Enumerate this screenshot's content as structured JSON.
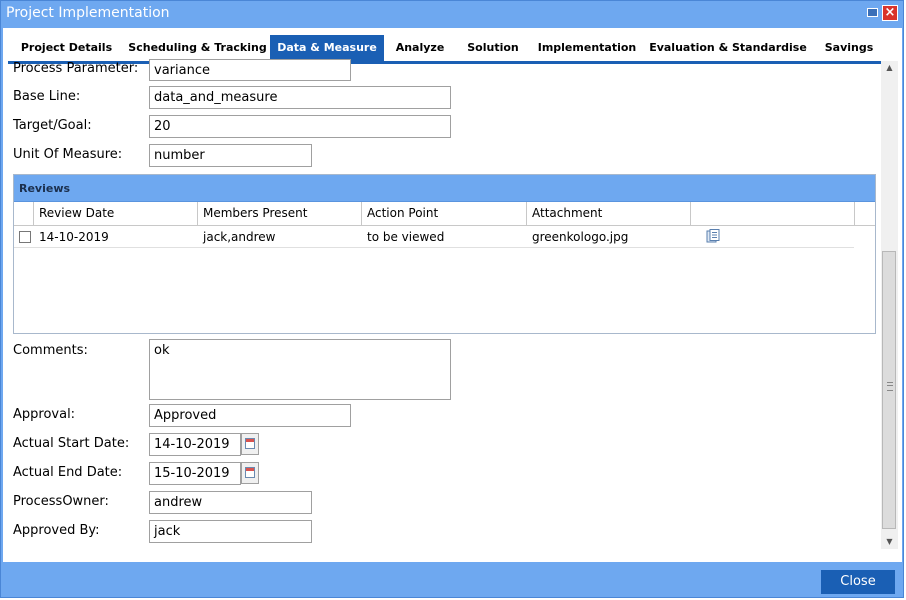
{
  "window": {
    "title": "Project Implementation",
    "close_button_label": "Close",
    "accent_color": "#1a5fb4",
    "header_color": "#6ea8f0"
  },
  "tabs": [
    {
      "label": "Project Details",
      "active": false
    },
    {
      "label": "Scheduling & Tracking",
      "active": false
    },
    {
      "label": "Data & Measure",
      "active": true
    },
    {
      "label": "Analyze",
      "active": false
    },
    {
      "label": "Solution",
      "active": false
    },
    {
      "label": "Implementation",
      "active": false
    },
    {
      "label": "Evaluation & Standardise",
      "active": false
    },
    {
      "label": "Savings",
      "active": false
    }
  ],
  "form": {
    "process_parameter": {
      "label": "Process Parameter:",
      "value": "variance"
    },
    "base_line": {
      "label": "Base Line:",
      "value": "data_and_measure"
    },
    "target_goal": {
      "label": "Target/Goal:",
      "value": "20"
    },
    "unit_of_measure": {
      "label": "Unit Of Measure:",
      "value": "number"
    },
    "comments": {
      "label": "Comments:",
      "value": "ok"
    },
    "approval": {
      "label": "Approval:",
      "value": "Approved"
    },
    "actual_start_date": {
      "label": "Actual Start Date:",
      "value": "14-10-2019"
    },
    "actual_end_date": {
      "label": "Actual End Date:",
      "value": "15-10-2019"
    },
    "process_owner": {
      "label": "ProcessOwner:",
      "value": "andrew"
    },
    "approved_by": {
      "label": "Approved By:",
      "value": "jack"
    }
  },
  "reviews": {
    "title": "Reviews",
    "columns": [
      "Review Date",
      "Members Present",
      "Action Point",
      "Attachment"
    ],
    "rows": [
      {
        "review_date": "14-10-2019",
        "members_present": "jack,andrew",
        "action_point": "to be viewed",
        "attachment": "greenkologo.jpg",
        "attachment_icon": "document-view-icon"
      }
    ]
  }
}
